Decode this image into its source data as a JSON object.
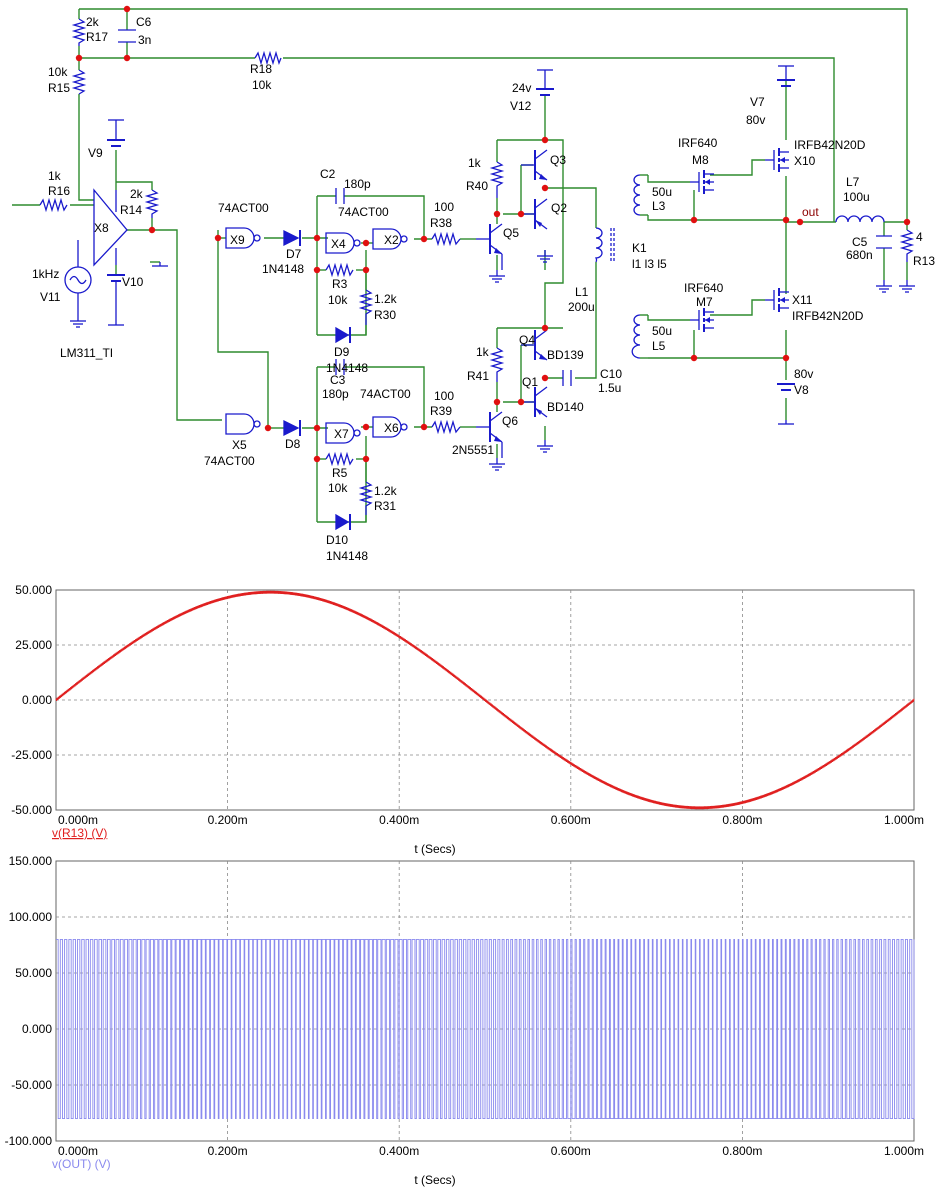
{
  "colors": {
    "wire": "#2e8b2e",
    "component": "#1a1acc",
    "node": "#e01010",
    "label": "#000000",
    "trace1": "#e02020",
    "trace2": "#8a8aee",
    "grid": "#888888"
  },
  "schematic": {
    "labels": {
      "r17_val": "2k",
      "r17": "R17",
      "c6": "C6",
      "c6_val": "3n",
      "r15_val": "10k",
      "r15": "R15",
      "r18": "R18",
      "r18_val": "10k",
      "r16_val": "1k",
      "r16": "R16",
      "v9": "V9",
      "r14_val": "2k",
      "r14": "R14",
      "x8": "X8",
      "v11_val": "1kHz",
      "v11": "V11",
      "v10": "V10",
      "lm311": "LM311_TI",
      "x9_type": "74ACT00",
      "x9": "X9",
      "d7": "D7",
      "d7_type": "1N4148",
      "c2": "C2",
      "c2_val": "180p",
      "x4_type": "74ACT00",
      "x4": "X4",
      "x2": "X2",
      "r38_val": "100",
      "r38": "R38",
      "r3": "R3",
      "r3_val": "10k",
      "r30_val": "1.2k",
      "r30": "R30",
      "d9": "D9",
      "d9_type": "1N4148",
      "c3": "C3",
      "c3_val": "180p",
      "x7_type": "74ACT00",
      "x7": "X7",
      "x6": "X6",
      "r39_val": "100",
      "r39": "R39",
      "x5": "X5",
      "x5_type": "74ACT00",
      "d8": "D8",
      "r5": "R5",
      "r5_val": "10k",
      "r31_val": "1.2k",
      "r31": "R31",
      "d10": "D10",
      "d10_type": "1N4148",
      "v12_val": "24v",
      "v12": "V12",
      "r40_val": "1k",
      "r40": "R40",
      "q3": "Q3",
      "q2": "Q2",
      "q5": "Q5",
      "k1": "K1",
      "k1_coils": "l1 l3 l5",
      "l1": "L1",
      "l1_val": "200u",
      "q4": "Q4",
      "bd139": "BD139",
      "r41_val": "1k",
      "r41": "R41",
      "q1": "Q1",
      "bd140": "BD140",
      "c10": "C10",
      "c10_val": "1.5u",
      "q6": "Q6",
      "q6_type": "2N5551",
      "m8_type": "IRF640",
      "m8": "M8",
      "l3_val": "50u",
      "l3": "L3",
      "v7": "V7",
      "v7_val": "80v",
      "x10_type": "IRFB42N20D",
      "x10": "X10",
      "out": "out",
      "l7": "L7",
      "l7_val": "100u",
      "c5": "C5",
      "c5_val": "680n",
      "r13_val": "4",
      "r13": "R13",
      "m7_type": "IRF640",
      "m7": "M7",
      "l5_val": "50u",
      "l5": "L5",
      "x11": "X11",
      "x11_type": "IRFB42N20D",
      "v8_val": "80v",
      "v8": "V8"
    }
  },
  "chart_data": [
    {
      "type": "line",
      "series": [
        {
          "name": "v(R13) (V)",
          "function": "sine",
          "amplitude": 49,
          "frequency_hz": 1000,
          "ripple": 0.6
        }
      ],
      "xlabel": "t (Secs)",
      "x_ticks": [
        "0.000m",
        "0.200m",
        "0.400m",
        "0.600m",
        "0.800m",
        "1.000m"
      ],
      "y_ticks": [
        "50.000",
        "25.000",
        "0.000",
        "-25.000",
        "-50.000"
      ],
      "xlim": [
        0,
        0.001
      ],
      "ylim": [
        -50,
        50
      ],
      "grid": true
    },
    {
      "type": "line",
      "series": [
        {
          "name": "v(OUT) (V)",
          "function": "pwm",
          "high": 80,
          "low": -80,
          "cycles": 200
        }
      ],
      "xlabel": "t (Secs)",
      "x_ticks": [
        "0.000m",
        "0.200m",
        "0.400m",
        "0.600m",
        "0.800m",
        "1.000m"
      ],
      "y_ticks": [
        "150.000",
        "100.000",
        "50.000",
        "0.000",
        "-50.000",
        "-100.000"
      ],
      "xlim": [
        0,
        0.001
      ],
      "ylim": [
        -100,
        150
      ],
      "grid": true
    }
  ]
}
